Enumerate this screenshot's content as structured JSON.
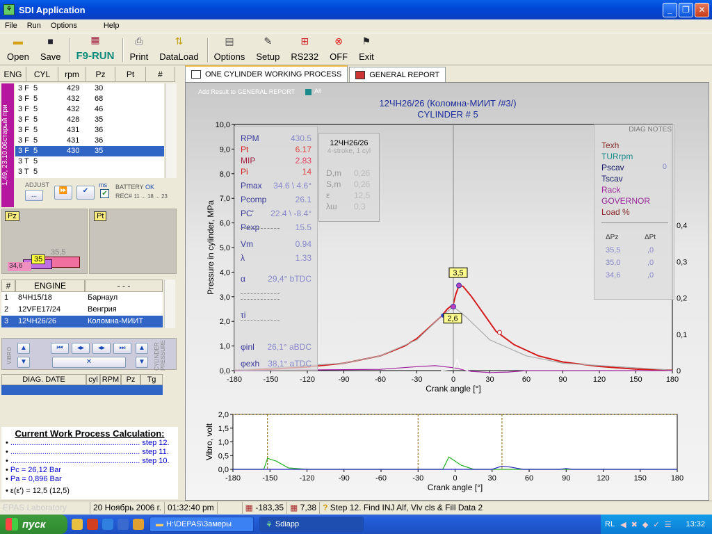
{
  "window": {
    "title": "SDI Application"
  },
  "menu": [
    "File",
    "Run",
    "Options",
    "Help"
  ],
  "toolbar": {
    "open": "Open",
    "save": "Save",
    "f9run": "F9-RUN",
    "print": "Print",
    "dataload": "DataLoad",
    "options": "Options",
    "setup": "Setup",
    "rs232": "RS232",
    "off": "OFF",
    "exit": "Exit"
  },
  "eng_table": {
    "headers": [
      "ENG",
      "CYL",
      "rpm",
      "Pz",
      "Pt",
      "#"
    ],
    "rows": [
      [
        "3 F",
        "5",
        "429",
        "30"
      ],
      [
        "3 F",
        "5",
        "432",
        "68"
      ],
      [
        "3 F",
        "5",
        "432",
        "46"
      ],
      [
        "3 F",
        "5",
        "428",
        "35"
      ],
      [
        "3 F",
        "5",
        "431",
        "36"
      ],
      [
        "3 F",
        "5",
        "431",
        "36"
      ],
      [
        "3 F",
        "5",
        "430",
        "35"
      ],
      [
        "3 T",
        "5",
        "",
        ""
      ],
      [
        "3 T",
        "5",
        "",
        ""
      ]
    ],
    "selected_index": 6
  },
  "side_label": "1,49, 23.10.06старый при",
  "adjust": {
    "label": "ADJUST",
    "ms": "ms",
    "battery": "BATTERY",
    "battery_status": "OK",
    "rec": "REC#",
    "rec_range": "11 ... 18 ... 23"
  },
  "pz_panel": {
    "label": "Pz",
    "values": [
      "35,5",
      "35",
      "34,6"
    ]
  },
  "pt_panel": {
    "label": "Pt"
  },
  "engine_list": {
    "headers": [
      "#",
      "ENGINE",
      "- - -"
    ],
    "rows": [
      [
        "1",
        "8ЧН15/18",
        "Барнаул"
      ],
      [
        "2",
        "12VFE17/24",
        "Венгрия"
      ],
      [
        "3",
        "12ЧН26/26",
        "Коломна-МИИТ"
      ]
    ],
    "selected_index": 2
  },
  "vibro_panel": {
    "left_label": "VIBRO",
    "right_label": "CYLINDER PRESSURE"
  },
  "diag_table": {
    "headers": [
      "DIAG. DATE",
      "cyl",
      "RPM",
      "Pz",
      "Tg"
    ]
  },
  "calc": {
    "title": "Current Work Process Calculation:",
    "steps": [
      "step 12.",
      "step 11.",
      "step 10."
    ],
    "pc": "Pc = 26,12 Bar",
    "pa": "Pa = 0,896 Bar",
    "eps": "ε(ε') = 12,5 (12,5)"
  },
  "tabs": [
    "ONE CYLINDER WORKING PROCESS",
    "GENERAL REPORT"
  ],
  "chart_head": {
    "add_result": "Add Result to GENERAL REPORT",
    "all": "All",
    "title1": "12ЧН26/26 (Коломна-МИИТ /#3/)",
    "title2": "CYLINDER # 5"
  },
  "params": [
    [
      "RPM",
      "430.5"
    ],
    [
      "Pt",
      "6.17"
    ],
    [
      "MIP",
      "2.83"
    ],
    [
      "Pi",
      "14"
    ],
    [
      "Pmax",
      "34.6 \\ 4.6°"
    ],
    [
      "Pcomp",
      "26.1"
    ],
    [
      "PC'",
      "22.4 \\ -8.4°"
    ],
    [
      "Pexp",
      "15.5"
    ],
    [
      "Vm",
      "0.94"
    ],
    [
      "λ",
      "1.33"
    ],
    [
      "α",
      "29,4° bTDC"
    ],
    [
      "τi",
      ""
    ],
    [
      "φinl",
      "26,1° aBDC"
    ],
    [
      "φexh",
      "38,1° aTDC"
    ]
  ],
  "engine_box": {
    "name": "12ЧН26/26",
    "sub": "4-stroke, 1 cyl",
    "rows": [
      [
        "D,m",
        "0,26"
      ],
      [
        "S,m",
        "0,26"
      ],
      [
        "ε",
        "12,5"
      ],
      [
        "λш",
        "0,3"
      ]
    ]
  },
  "diag_notes": {
    "title": "DIAG NOTES",
    "items": [
      "Texh",
      "TURrpm",
      "Pscav",
      "Tscav",
      "Rack",
      "GOVERNOR",
      "Load %"
    ],
    "pscav_value": "0",
    "delta_headers": [
      "ΔPz",
      "ΔPt"
    ],
    "deltas": [
      [
        "35,5",
        ",0"
      ],
      [
        "35,0",
        ",0"
      ],
      [
        "34,6",
        ",0"
      ]
    ]
  },
  "chart_data": [
    {
      "type": "line",
      "ylabel": "Pressure in cylinder, MPa",
      "xlabel": "Crank angle [°]",
      "xlim": [
        -180,
        180
      ],
      "ylim": [
        0,
        10
      ],
      "xticks": [
        -180,
        -150,
        -120,
        -90,
        -60,
        -30,
        0,
        30,
        60,
        90,
        120,
        150,
        180
      ],
      "yticks": [
        "0,0",
        "1,0",
        "2,0",
        "3,0",
        "4,0",
        "5,0",
        "6,0",
        "7,0",
        "8,0",
        "9,0",
        "10,0"
      ],
      "y2ticks": [
        "0",
        "0,1",
        "0,2",
        "0,3",
        "0,4"
      ],
      "markers": [
        "3,5",
        "2,6"
      ],
      "series": [
        {
          "color": "#d41a1a",
          "points": [
            [
              -180,
              0.02
            ],
            [
              -150,
              0.06
            ],
            [
              -120,
              0.15
            ],
            [
              -90,
              0.3
            ],
            [
              -60,
              0.6
            ],
            [
              -40,
              1.0
            ],
            [
              -30,
              1.3
            ],
            [
              -20,
              1.75
            ],
            [
              -10,
              2.2
            ],
            [
              -5,
              2.5
            ],
            [
              0,
              2.7
            ],
            [
              2,
              3.1
            ],
            [
              4.6,
              3.46
            ],
            [
              8,
              3.42
            ],
            [
              15,
              3.0
            ],
            [
              25,
              2.3
            ],
            [
              35,
              1.6
            ],
            [
              50,
              1.05
            ],
            [
              70,
              0.6
            ],
            [
              90,
              0.35
            ],
            [
              120,
              0.17
            ],
            [
              150,
              0.06
            ],
            [
              180,
              0.02
            ]
          ]
        },
        {
          "color": "#a8a8a8",
          "points": [
            [
              -180,
              0.02
            ],
            [
              -90,
              0.3
            ],
            [
              -60,
              0.6
            ],
            [
              -30,
              1.25
            ],
            [
              -10,
              2.2
            ],
            [
              0,
              2.6
            ],
            [
              10,
              2.2
            ],
            [
              30,
              1.25
            ],
            [
              60,
              0.6
            ],
            [
              90,
              0.3
            ],
            [
              180,
              0.02
            ]
          ]
        },
        {
          "color": "#a020a0",
          "points": [
            [
              -180,
              0.0
            ],
            [
              -60,
              0.05
            ],
            [
              -30,
              0.16
            ],
            [
              -15,
              0.2
            ],
            [
              0,
              0.12
            ],
            [
              15,
              -0.03
            ],
            [
              30,
              -0.08
            ],
            [
              45,
              -0.06
            ],
            [
              60,
              0.0
            ],
            [
              180,
              0.0
            ]
          ]
        },
        {
          "color": "#ffffff",
          "points": [
            [
              -10,
              0.0
            ],
            [
              0,
              0.05
            ],
            [
              3,
              0.45
            ],
            [
              6,
              0.1
            ],
            [
              12,
              0.0
            ]
          ]
        }
      ]
    },
    {
      "type": "line",
      "ylabel": "Vibro, volt",
      "xlabel": "Crank angle [°]",
      "xlim": [
        -180,
        180
      ],
      "ylim": [
        0,
        2
      ],
      "xticks": [
        -180,
        -150,
        -120,
        -90,
        -60,
        -30,
        0,
        30,
        60,
        90,
        120,
        150,
        180
      ],
      "yticks": [
        "0,0",
        "0,5",
        "1,0",
        "1,5",
        "2,0"
      ],
      "series": [
        {
          "color": "#22b022",
          "points": [
            [
              -180,
              0
            ],
            [
              -155,
              0
            ],
            [
              -152,
              0.4
            ],
            [
              -145,
              0.3
            ],
            [
              -135,
              0.05
            ],
            [
              -120,
              0
            ],
            [
              -10,
              0
            ],
            [
              -5,
              0.45
            ],
            [
              5,
              0.15
            ],
            [
              15,
              0
            ],
            [
              180,
              0
            ]
          ]
        },
        {
          "color": "#2222c0",
          "points": [
            [
              -180,
              0
            ],
            [
              30,
              0
            ],
            [
              38,
              0.12
            ],
            [
              45,
              0.08
            ],
            [
              55,
              0
            ],
            [
              85,
              0
            ],
            [
              90,
              0.03
            ],
            [
              95,
              0
            ],
            [
              180,
              0
            ]
          ]
        }
      ]
    }
  ],
  "status": {
    "lab": "EPAS Laboratory",
    "date": "20 Ноябрь 2006 г.",
    "time": "01:32:40 pm",
    "angle": "-183,35",
    "value": "7,38",
    "message": "Step 12. Find INJ Alf, Vlv cls & Fill Data 2"
  },
  "taskbar": {
    "start": "пуск",
    "items": [
      "H:\\DEPAS\\Замеры",
      "Sdiapp"
    ],
    "lang": "RL",
    "clock": "13:32"
  }
}
